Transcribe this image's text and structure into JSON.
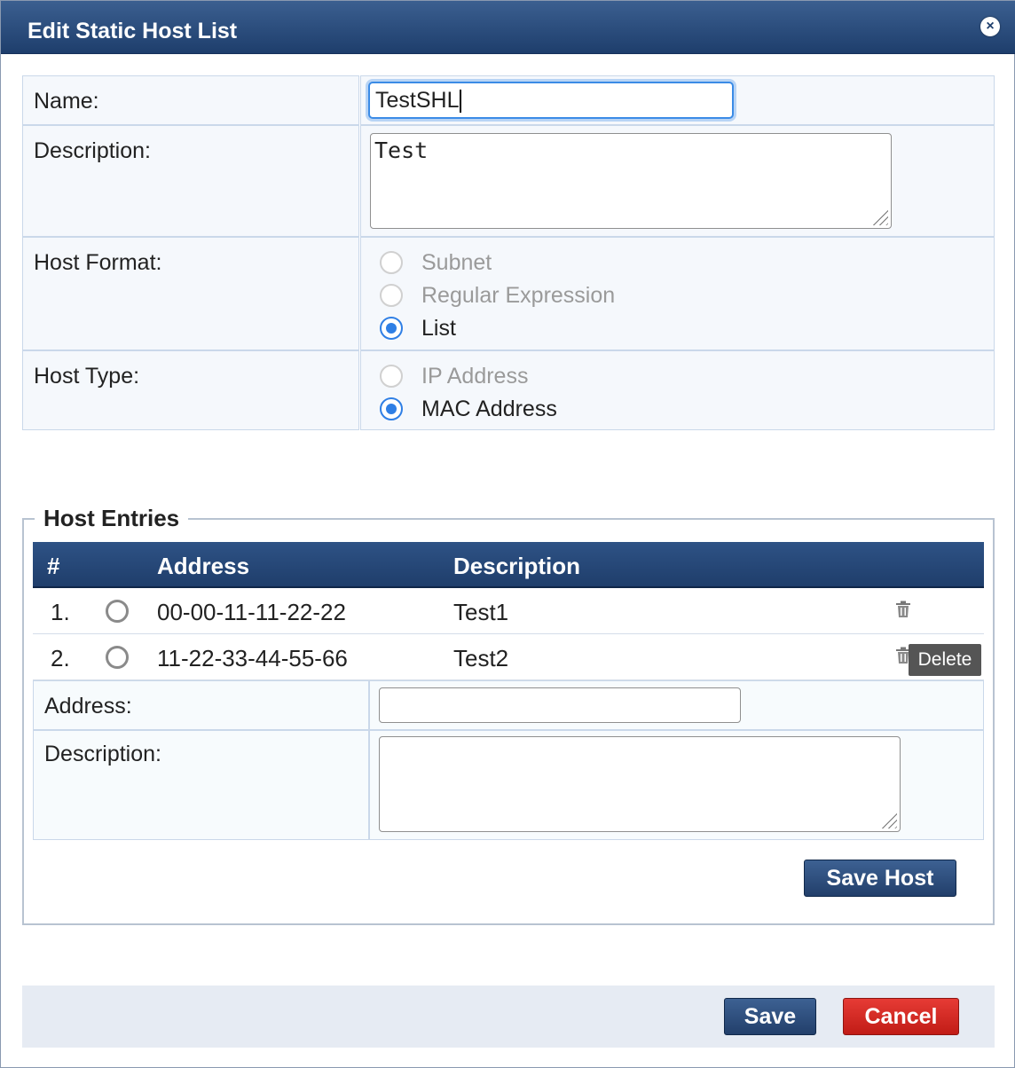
{
  "dialog": {
    "title": "Edit Static Host List",
    "close_glyph": "×"
  },
  "form": {
    "name_label": "Name:",
    "name_value": "TestSHL",
    "description_label": "Description:",
    "description_value": "Test",
    "host_format_label": "Host Format:",
    "host_format_options": [
      {
        "label": "Subnet",
        "checked": false,
        "disabled": true
      },
      {
        "label": "Regular Expression",
        "checked": false,
        "disabled": true
      },
      {
        "label": "List",
        "checked": true,
        "disabled": false
      }
    ],
    "host_type_label": "Host Type:",
    "host_type_options": [
      {
        "label": "IP Address",
        "checked": false,
        "disabled": true
      },
      {
        "label": "MAC Address",
        "checked": true,
        "disabled": false
      }
    ]
  },
  "host_entries": {
    "legend": "Host Entries",
    "columns": [
      "#",
      "Address",
      "Description"
    ],
    "rows": [
      {
        "index": "1.",
        "address": "00-00-11-11-22-22",
        "description": "Test1"
      },
      {
        "index": "2.",
        "address": "11-22-33-44-55-66",
        "description": "Test2"
      }
    ],
    "delete_tooltip": "Delete",
    "address_label": "Address:",
    "address_value": "",
    "description_label": "Description:",
    "description_value": "",
    "save_host_label": "Save Host"
  },
  "footer": {
    "save_label": "Save",
    "cancel_label": "Cancel"
  },
  "colors": {
    "header_blue": "#1e3e6c",
    "accent_radio": "#2f7fe5",
    "cancel_red": "#d42a24",
    "cell_bg": "#f5f8fc"
  },
  "icons": [
    "close-icon",
    "trash-icon"
  ]
}
